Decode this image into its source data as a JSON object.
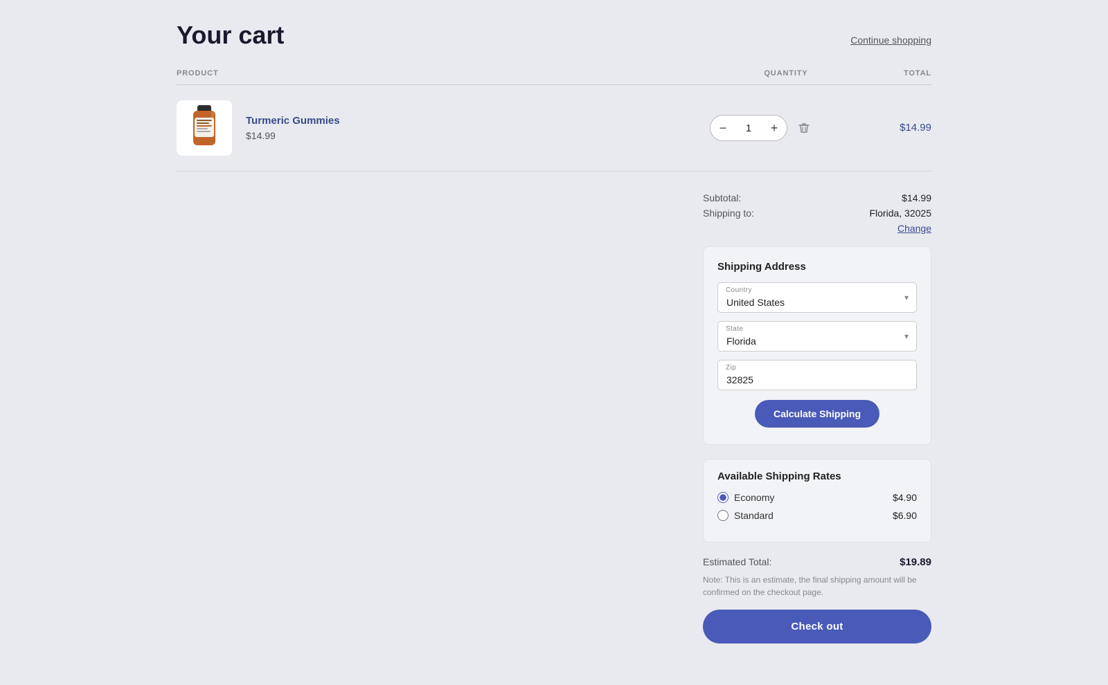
{
  "page": {
    "title": "Your cart",
    "continue_shopping": "Continue shopping",
    "background": "#e8eaf0"
  },
  "columns": {
    "product": "PRODUCT",
    "quantity": "QUANTITY",
    "total": "TOTAL"
  },
  "cart_item": {
    "name": "Turmeric Gummies",
    "price": "$14.99",
    "quantity": "1",
    "item_total": "$14.99"
  },
  "summary": {
    "subtotal_label": "Subtotal:",
    "subtotal_value": "$14.99",
    "shipping_to_label": "Shipping to:",
    "shipping_to_value": "Florida, 32025",
    "change_link": "Change"
  },
  "shipping_address": {
    "title": "Shipping Address",
    "country_label": "Country",
    "country_value": "United States",
    "state_label": "State",
    "state_value": "Florida",
    "zip_label": "Zip",
    "zip_value": "32825",
    "calculate_btn": "Calculate Shipping"
  },
  "shipping_rates": {
    "title": "Available Shipping Rates",
    "rates": [
      {
        "id": "economy",
        "label": "Economy",
        "price": "$4.90",
        "selected": true
      },
      {
        "id": "standard",
        "label": "Standard",
        "price": "$6.90",
        "selected": false
      }
    ]
  },
  "estimated": {
    "label": "Estimated Total:",
    "value": "$19.89",
    "note": "Note: This is an estimate, the final shipping amount will be confirmed on the checkout page.",
    "checkout_btn": "Check out"
  }
}
